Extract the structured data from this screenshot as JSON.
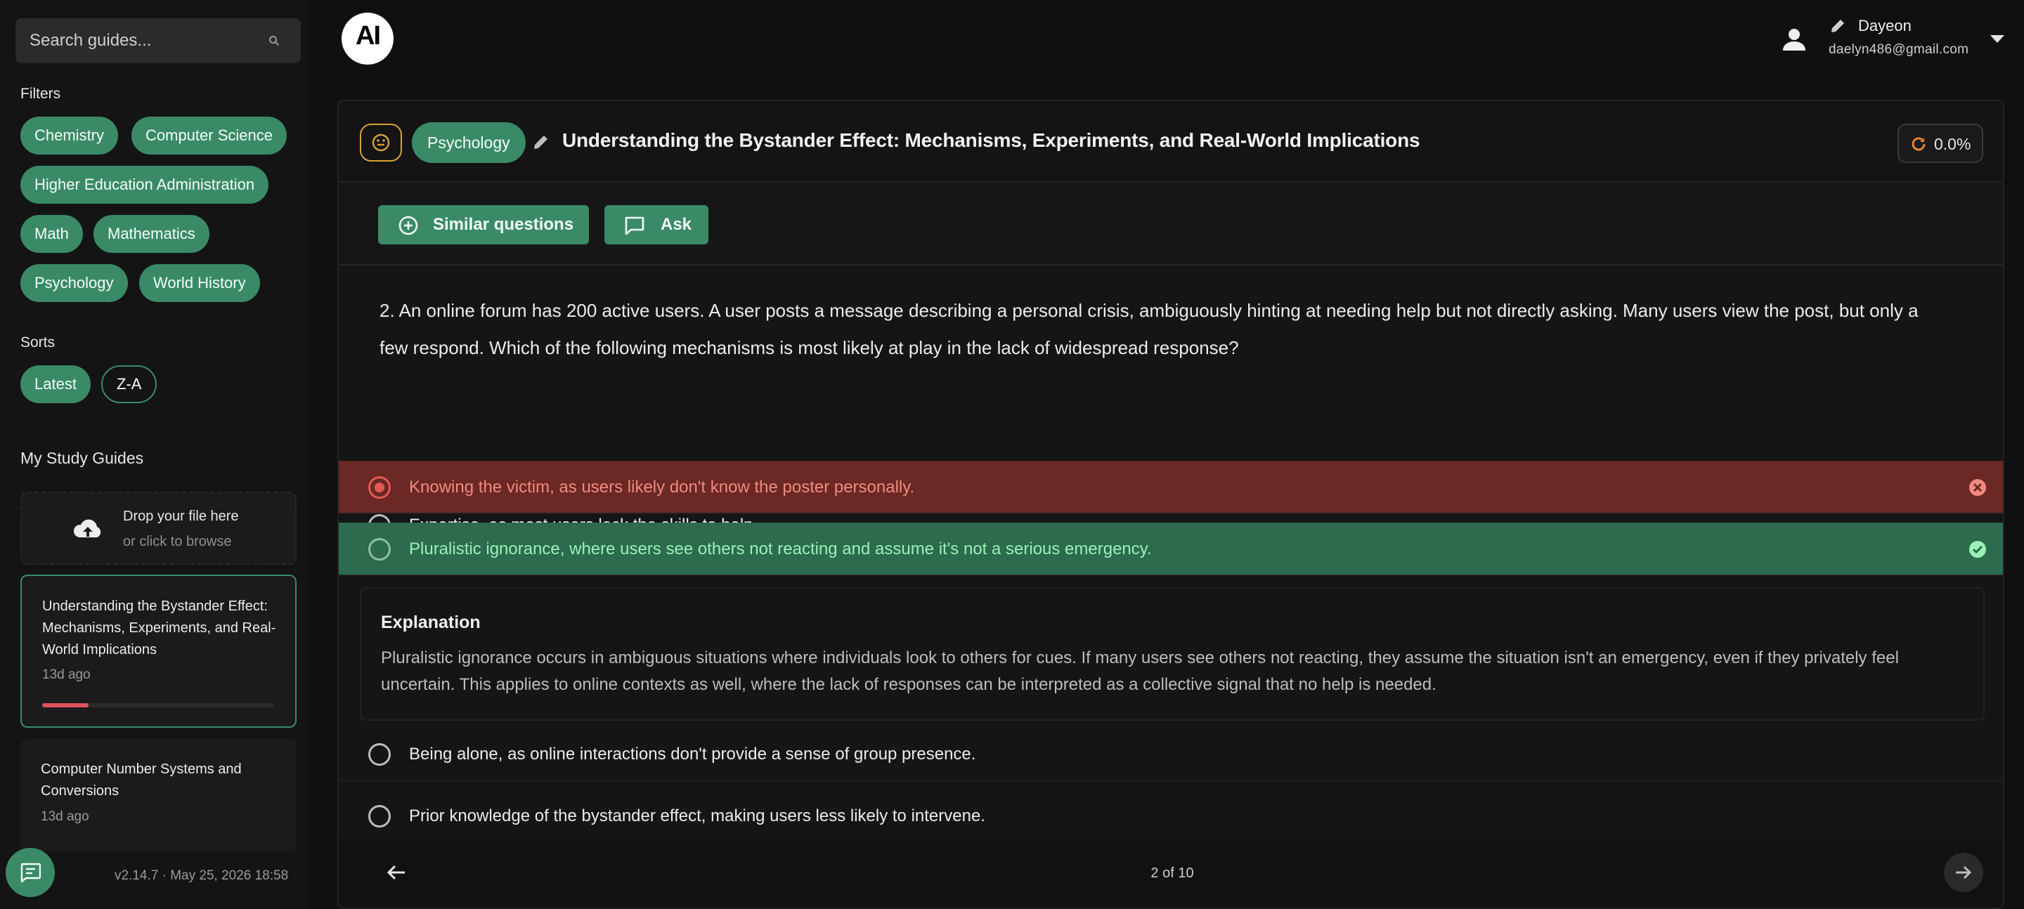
{
  "sidebar": {
    "search_placeholder": "Search guides...",
    "filters_title": "Filters",
    "filters": [
      "Chemistry",
      "Computer Science",
      "Higher Education Administration",
      "Math",
      "Mathematics",
      "Psychology",
      "World History"
    ],
    "sorts_title": "Sorts",
    "sorts": [
      "Latest",
      "Z-A"
    ],
    "my_study_guides_title": "My Study Guides",
    "dropzone": {
      "line1": "Drop your file here",
      "line2": "or click to browse"
    },
    "guides": [
      {
        "title": "Understanding the Bystander Effect: Mechanisms, Experiments, and Real-World Implications",
        "ago": "13d ago",
        "progress": 0.2
      },
      {
        "title": "Computer Number Systems and Conversions",
        "ago": "13d ago"
      }
    ],
    "version": "v2.14.7 · May 25, 2026 18:58"
  },
  "header": {
    "logo_text": "AI",
    "user_name": "Dayeon",
    "user_email": "daelyn486@gmail.com"
  },
  "guide": {
    "subject": "Psychology",
    "title": "Understanding the Bystander Effect: Mechanisms, Experiments, and Real-World Implications",
    "progress": "0.0%"
  },
  "actions": {
    "similar": "Similar questions",
    "ask": "Ask"
  },
  "question": {
    "text": "2. An online forum has 200 active users. A user posts a message describing a personal crisis, ambiguously hinting at needing help but not directly asking. Many users view the post, but only a few respond. Which of the following mechanisms is most likely at play in the lack of widespread response?",
    "options": [
      "Expertise, as most users lack the skills to help.",
      "Knowing the victim, as users likely don't know the poster personally.",
      "Pluralistic ignorance, where users see others not reacting and assume it's not a serious emergency.",
      "Being alone, as online interactions don't provide a sense of group presence.",
      "Prior knowledge of the bystander effect, making users less likely to intervene."
    ],
    "selected_index": 1,
    "correct_index": 2,
    "explanation_title": "Explanation",
    "explanation": "Pluralistic ignorance occurs in ambiguous situations where individuals look to others for cues. If many users see others not reacting, they assume the situation isn't an emergency, even if they privately feel uncertain. This applies to online contexts as well, where the lack of responses can be interpreted as a collective signal that no help is needed."
  },
  "pagination": {
    "label": "2 of 10"
  },
  "colors": {
    "accent": "#3b8a67",
    "wrong_bg": "#6b2824",
    "right_bg": "#2c6b4e"
  }
}
